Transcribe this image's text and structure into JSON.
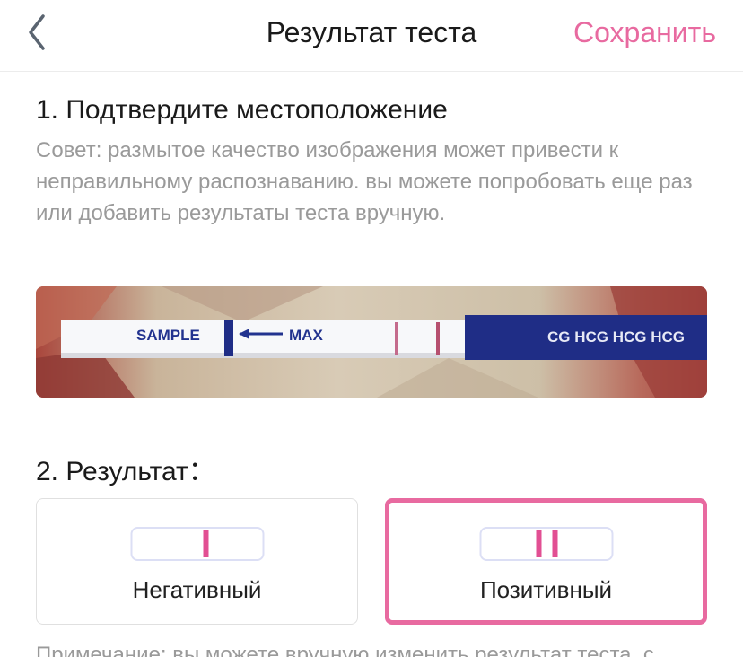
{
  "header": {
    "title": "Результат теста",
    "save_label": "Сохранить",
    "back_icon": "chevron-left-icon",
    "accent_color": "#e86aa0"
  },
  "step1": {
    "title": "1. Подтвердите местоположение",
    "tip": "Совет: размытое качество изображения может привести к неправильному распознаванию. вы можете попробовать еще раз или добавить результаты теста вручную."
  },
  "test_photo": {
    "sample_text": "SAMPLE",
    "max_text": "MAX",
    "brand_text": "CG HCG HCG HCG"
  },
  "step2": {
    "title": "2. Результат：",
    "options": [
      {
        "label": "Негативный",
        "lines": 1,
        "selected": false
      },
      {
        "label": "Позитивный",
        "lines": 2,
        "selected": true
      }
    ]
  },
  "note": "Примечание: вы можете вручную изменить результат теста, с"
}
